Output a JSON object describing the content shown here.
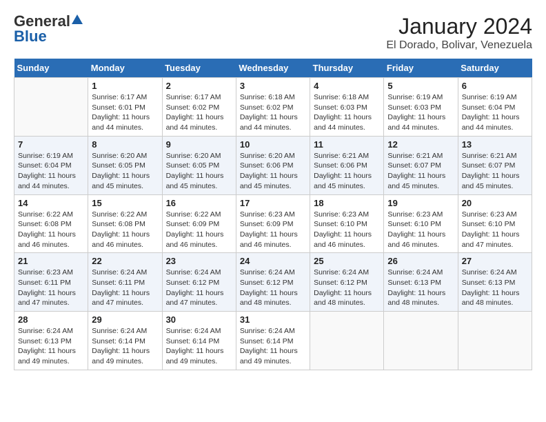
{
  "header": {
    "logo_general": "General",
    "logo_blue": "Blue",
    "title": "January 2024",
    "location": "El Dorado, Bolivar, Venezuela"
  },
  "calendar": {
    "days_of_week": [
      "Sunday",
      "Monday",
      "Tuesday",
      "Wednesday",
      "Thursday",
      "Friday",
      "Saturday"
    ],
    "weeks": [
      [
        {
          "day": null
        },
        {
          "day": "1",
          "sunrise": "6:17 AM",
          "sunset": "6:01 PM",
          "daylight": "11 hours and 44 minutes."
        },
        {
          "day": "2",
          "sunrise": "6:17 AM",
          "sunset": "6:02 PM",
          "daylight": "11 hours and 44 minutes."
        },
        {
          "day": "3",
          "sunrise": "6:18 AM",
          "sunset": "6:02 PM",
          "daylight": "11 hours and 44 minutes."
        },
        {
          "day": "4",
          "sunrise": "6:18 AM",
          "sunset": "6:03 PM",
          "daylight": "11 hours and 44 minutes."
        },
        {
          "day": "5",
          "sunrise": "6:19 AM",
          "sunset": "6:03 PM",
          "daylight": "11 hours and 44 minutes."
        },
        {
          "day": "6",
          "sunrise": "6:19 AM",
          "sunset": "6:04 PM",
          "daylight": "11 hours and 44 minutes."
        }
      ],
      [
        {
          "day": "7",
          "sunrise": "6:19 AM",
          "sunset": "6:04 PM",
          "daylight": "11 hours and 44 minutes."
        },
        {
          "day": "8",
          "sunrise": "6:20 AM",
          "sunset": "6:05 PM",
          "daylight": "11 hours and 45 minutes."
        },
        {
          "day": "9",
          "sunrise": "6:20 AM",
          "sunset": "6:05 PM",
          "daylight": "11 hours and 45 minutes."
        },
        {
          "day": "10",
          "sunrise": "6:20 AM",
          "sunset": "6:06 PM",
          "daylight": "11 hours and 45 minutes."
        },
        {
          "day": "11",
          "sunrise": "6:21 AM",
          "sunset": "6:06 PM",
          "daylight": "11 hours and 45 minutes."
        },
        {
          "day": "12",
          "sunrise": "6:21 AM",
          "sunset": "6:07 PM",
          "daylight": "11 hours and 45 minutes."
        },
        {
          "day": "13",
          "sunrise": "6:21 AM",
          "sunset": "6:07 PM",
          "daylight": "11 hours and 45 minutes."
        }
      ],
      [
        {
          "day": "14",
          "sunrise": "6:22 AM",
          "sunset": "6:08 PM",
          "daylight": "11 hours and 46 minutes."
        },
        {
          "day": "15",
          "sunrise": "6:22 AM",
          "sunset": "6:08 PM",
          "daylight": "11 hours and 46 minutes."
        },
        {
          "day": "16",
          "sunrise": "6:22 AM",
          "sunset": "6:09 PM",
          "daylight": "11 hours and 46 minutes."
        },
        {
          "day": "17",
          "sunrise": "6:23 AM",
          "sunset": "6:09 PM",
          "daylight": "11 hours and 46 minutes."
        },
        {
          "day": "18",
          "sunrise": "6:23 AM",
          "sunset": "6:10 PM",
          "daylight": "11 hours and 46 minutes."
        },
        {
          "day": "19",
          "sunrise": "6:23 AM",
          "sunset": "6:10 PM",
          "daylight": "11 hours and 46 minutes."
        },
        {
          "day": "20",
          "sunrise": "6:23 AM",
          "sunset": "6:10 PM",
          "daylight": "11 hours and 47 minutes."
        }
      ],
      [
        {
          "day": "21",
          "sunrise": "6:23 AM",
          "sunset": "6:11 PM",
          "daylight": "11 hours and 47 minutes."
        },
        {
          "day": "22",
          "sunrise": "6:24 AM",
          "sunset": "6:11 PM",
          "daylight": "11 hours and 47 minutes."
        },
        {
          "day": "23",
          "sunrise": "6:24 AM",
          "sunset": "6:12 PM",
          "daylight": "11 hours and 47 minutes."
        },
        {
          "day": "24",
          "sunrise": "6:24 AM",
          "sunset": "6:12 PM",
          "daylight": "11 hours and 48 minutes."
        },
        {
          "day": "25",
          "sunrise": "6:24 AM",
          "sunset": "6:12 PM",
          "daylight": "11 hours and 48 minutes."
        },
        {
          "day": "26",
          "sunrise": "6:24 AM",
          "sunset": "6:13 PM",
          "daylight": "11 hours and 48 minutes."
        },
        {
          "day": "27",
          "sunrise": "6:24 AM",
          "sunset": "6:13 PM",
          "daylight": "11 hours and 48 minutes."
        }
      ],
      [
        {
          "day": "28",
          "sunrise": "6:24 AM",
          "sunset": "6:13 PM",
          "daylight": "11 hours and 49 minutes."
        },
        {
          "day": "29",
          "sunrise": "6:24 AM",
          "sunset": "6:14 PM",
          "daylight": "11 hours and 49 minutes."
        },
        {
          "day": "30",
          "sunrise": "6:24 AM",
          "sunset": "6:14 PM",
          "daylight": "11 hours and 49 minutes."
        },
        {
          "day": "31",
          "sunrise": "6:24 AM",
          "sunset": "6:14 PM",
          "daylight": "11 hours and 49 minutes."
        },
        {
          "day": null
        },
        {
          "day": null
        },
        {
          "day": null
        }
      ]
    ]
  }
}
